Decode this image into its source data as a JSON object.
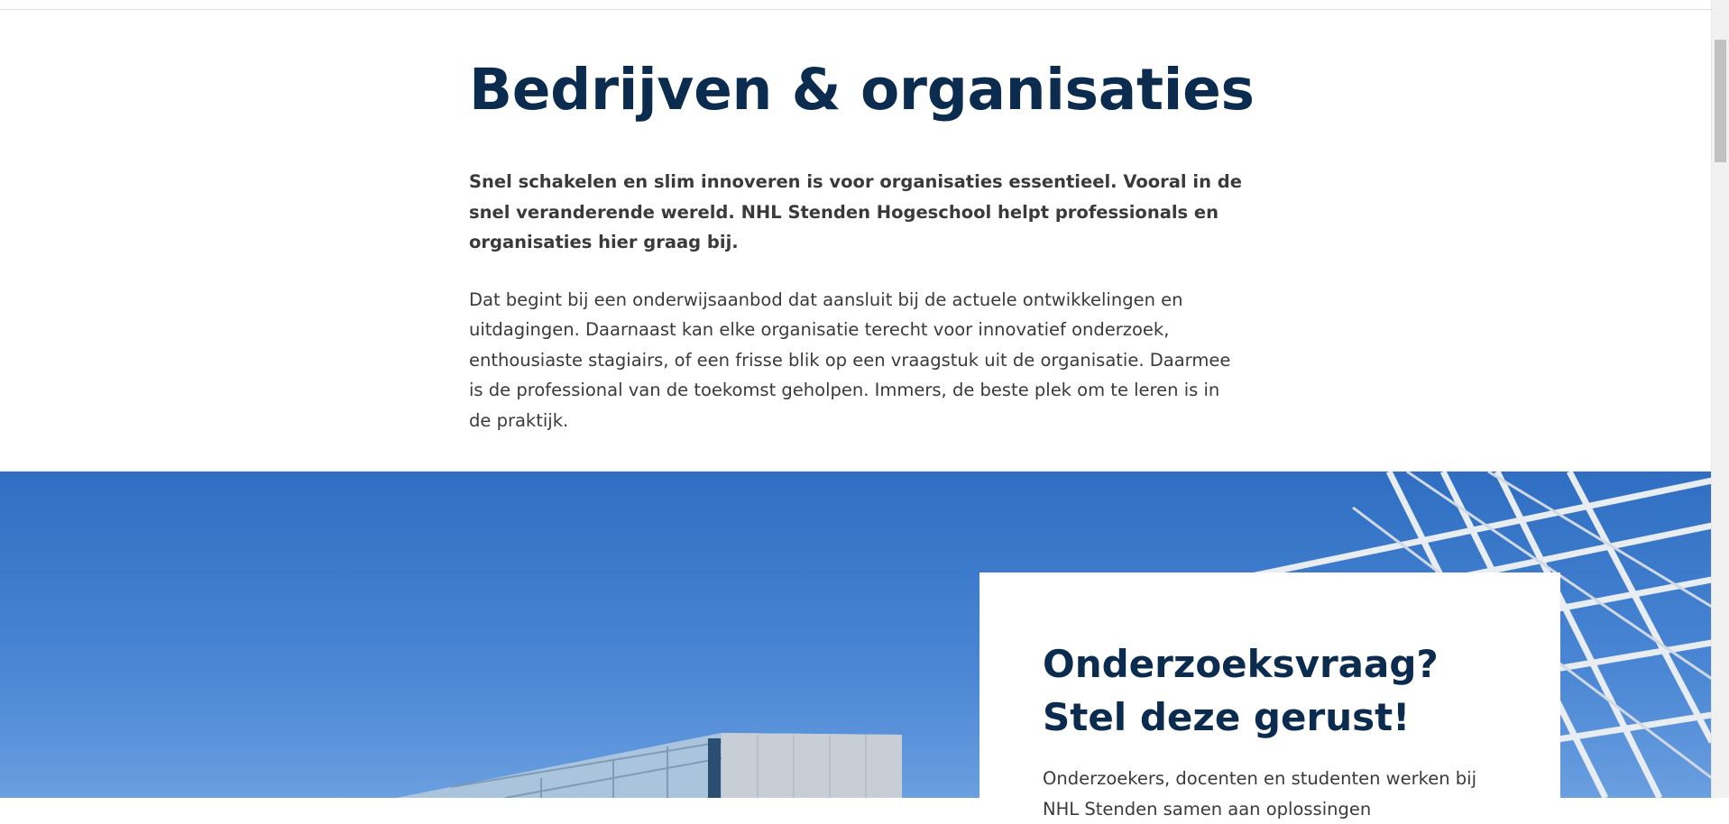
{
  "intro": {
    "title": "Bedrijven & organisaties",
    "lead": "Snel schakelen en slim innoveren is voor organisaties essentieel. Vooral in de snel veranderende wereld. NHL Stenden Hogeschool helpt professionals en organisaties hier graag bij.",
    "body": "Dat begint bij een onderwijsaanbod dat aansluit bij de actuele ontwikkelingen en uitdagingen. Daarnaast kan elke organisatie terecht voor innovatief onderzoek, enthousiaste stagiairs, of een frisse blik op een vraagstuk uit de organisatie. Daarmee is de professional van de toekomst geholpen. Immers, de beste plek om te leren is in de praktijk."
  },
  "card": {
    "title": "Onderzoeksvraag? Stel deze gerust!",
    "text": "Onderzoekers, docenten en studenten werken bij NHL Stenden samen aan oplossingen"
  },
  "colors": {
    "heading": "#0b2b4f",
    "sky": "#2f6ec2"
  }
}
